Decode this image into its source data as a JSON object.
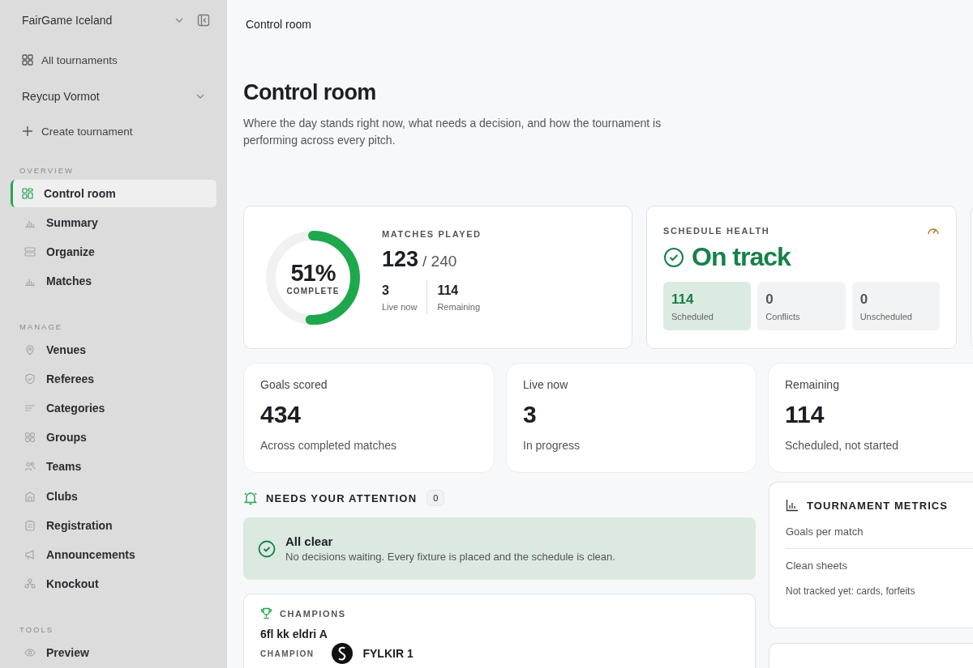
{
  "sidebar": {
    "org": {
      "name": "FairGame Iceland"
    },
    "all_tournaments": "All tournaments",
    "tournament": {
      "name": "Reycup Vormot"
    },
    "create": "Create tournament",
    "sections": [
      {
        "title": "OVERVIEW",
        "items": [
          {
            "label": "Control room",
            "selected": true
          },
          {
            "label": "Summary",
            "selected": false
          },
          {
            "label": "Organize",
            "selected": false
          },
          {
            "label": "Matches",
            "selected": false
          }
        ]
      },
      {
        "title": "MANAGE",
        "items": [
          {
            "label": "Venues",
            "selected": false
          },
          {
            "label": "Referees",
            "selected": false
          },
          {
            "label": "Categories",
            "selected": false
          },
          {
            "label": "Groups",
            "selected": false
          },
          {
            "label": "Teams",
            "selected": false
          },
          {
            "label": "Clubs",
            "selected": false
          },
          {
            "label": "Registration",
            "selected": false
          },
          {
            "label": "Announcements",
            "selected": false
          },
          {
            "label": "Knockout",
            "selected": false
          }
        ]
      },
      {
        "title": "TOOLS",
        "items": [
          {
            "label": "Preview",
            "selected": false
          }
        ]
      }
    ]
  },
  "breadcrumb": "Control room",
  "page": {
    "title": "Control room",
    "description": "Where the day stands right now, what needs a decision, and how the tournament is performing across every pitch."
  },
  "progress": {
    "percent": "51%",
    "caption": "COMPLETE",
    "level": 0.51,
    "title": "MATCHES PLAYED",
    "played": "123",
    "total": "/ 240",
    "stats": [
      {
        "value": "3",
        "label": "Live now"
      },
      {
        "value": "114",
        "label": "Remaining"
      }
    ]
  },
  "schedule_health": {
    "title": "SCHEDULE HEALTH",
    "status": "On track",
    "tiles": [
      {
        "value": "114",
        "label": "Scheduled",
        "kind": "positive"
      },
      {
        "value": "0",
        "label": "Conflicts",
        "kind": "neutral"
      },
      {
        "value": "0",
        "label": "Unscheduled",
        "kind": "neutral"
      }
    ]
  },
  "kpis": [
    {
      "label": "Goals scored",
      "value": "434",
      "note": "Across completed matches"
    },
    {
      "label": "Live now",
      "value": "3",
      "note": "In progress"
    },
    {
      "label": "Remaining",
      "value": "114",
      "note": "Scheduled, not started"
    }
  ],
  "attention": {
    "title": "NEEDS YOUR ATTENTION",
    "count": "0",
    "status": {
      "title": "All clear",
      "text": "No decisions waiting. Every fixture is placed and the schedule is clean."
    }
  },
  "champions": {
    "title": "CHAMPIONS",
    "category": "6fl kk eldri A",
    "label": "CHAMPION",
    "team": "FYLKIR 1"
  },
  "metrics": {
    "title": "TOURNAMENT METRICS",
    "rows": [
      "Goals per match",
      "Clean sheets"
    ],
    "note": "Not tracked yet: cards, forfeits"
  }
}
